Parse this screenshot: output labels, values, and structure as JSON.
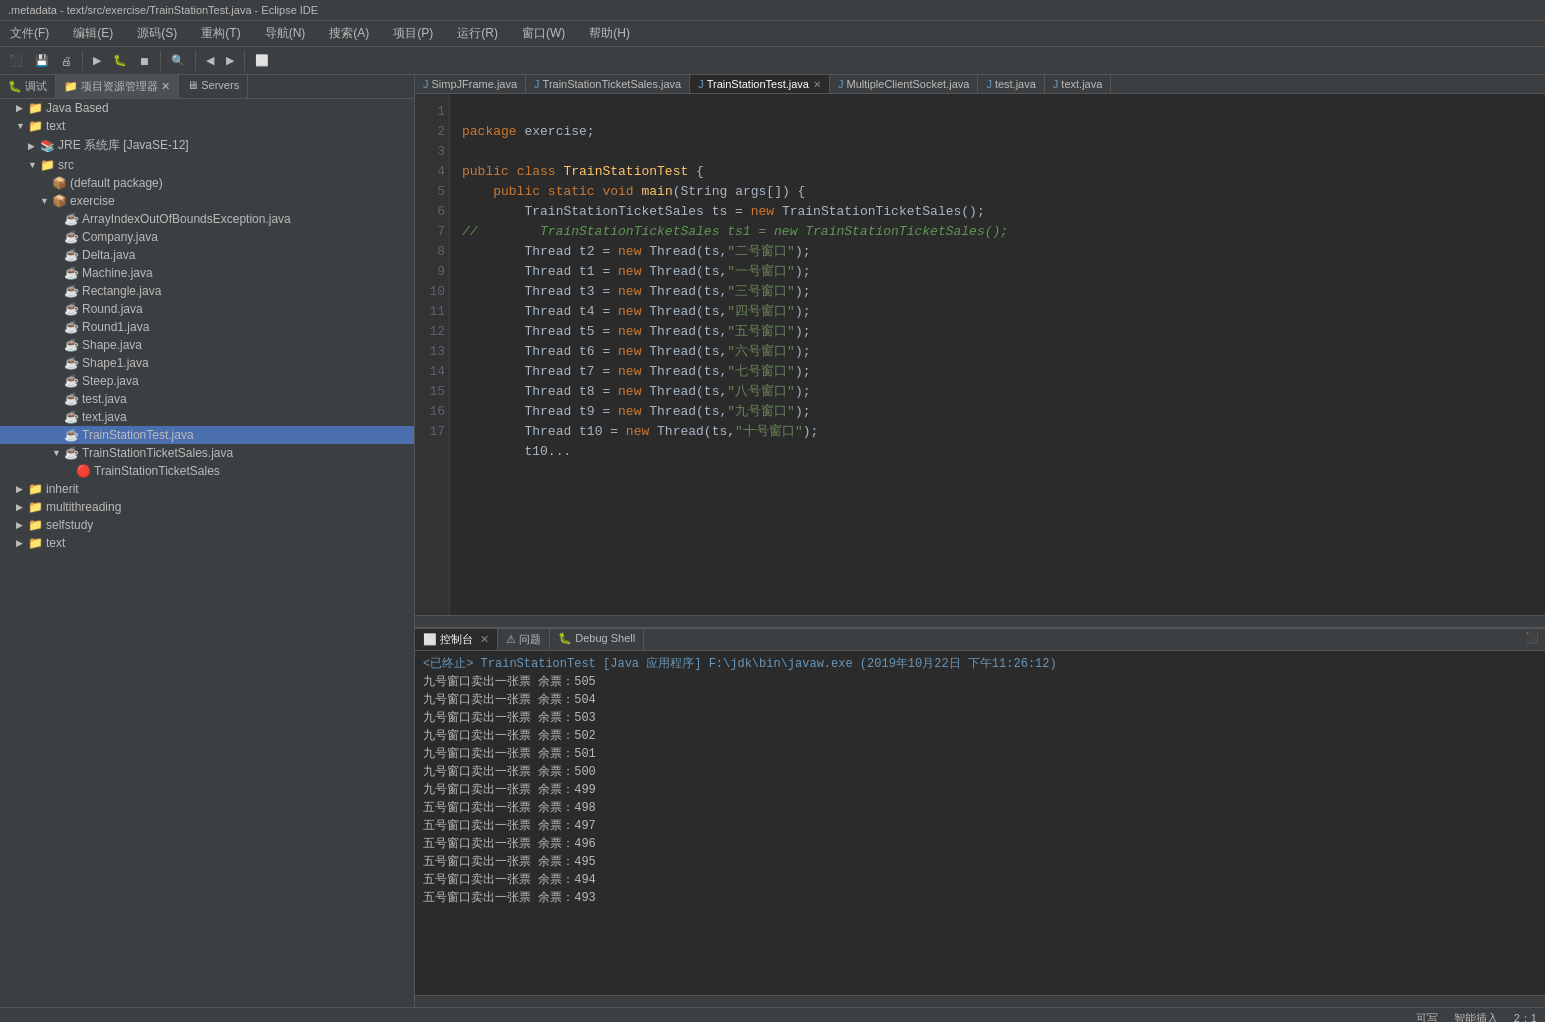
{
  "titleBar": {
    "text": ".metadata - text/src/exercise/TrainStationTest.java - Eclipse IDE"
  },
  "menuBar": {
    "items": [
      "文件(F)",
      "编辑(E)",
      "源码(S)",
      "重构(T)",
      "导航(N)",
      "搜索(A)",
      "项目(P)",
      "运行(R)",
      "窗口(W)",
      "帮助(H)"
    ]
  },
  "sidebar": {
    "tabs": [
      "调试",
      "项目资源管理器",
      "Servers"
    ],
    "tree": [
      {
        "label": "Java Based",
        "level": 1,
        "icon": "📁",
        "expanded": true
      },
      {
        "label": "text",
        "level": 1,
        "icon": "📁",
        "expanded": true
      },
      {
        "label": "JRE 系统库 [JavaSE-12]",
        "level": 2,
        "icon": "📚",
        "expanded": false
      },
      {
        "label": "src",
        "level": 2,
        "icon": "📁",
        "expanded": true
      },
      {
        "label": "(default package)",
        "level": 3,
        "icon": "📦",
        "expanded": false
      },
      {
        "label": "exercise",
        "level": 3,
        "icon": "📦",
        "expanded": true
      },
      {
        "label": "ArrayIndexOutOfBoundsException.java",
        "level": 4,
        "icon": "☕"
      },
      {
        "label": "Company.java",
        "level": 4,
        "icon": "☕"
      },
      {
        "label": "Delta.java",
        "level": 4,
        "icon": "☕"
      },
      {
        "label": "Machine.java",
        "level": 4,
        "icon": "☕"
      },
      {
        "label": "Rectangle.java",
        "level": 4,
        "icon": "☕"
      },
      {
        "label": "Round.java",
        "level": 4,
        "icon": "☕"
      },
      {
        "label": "Round1.java",
        "level": 4,
        "icon": "☕"
      },
      {
        "label": "Shape.java",
        "level": 4,
        "icon": "☕"
      },
      {
        "label": "Shape1.java",
        "level": 4,
        "icon": "☕"
      },
      {
        "label": "Steep.java",
        "level": 4,
        "icon": "☕"
      },
      {
        "label": "test.java",
        "level": 4,
        "icon": "☕"
      },
      {
        "label": "text.java",
        "level": 4,
        "icon": "☕"
      },
      {
        "label": "TrainStationTest.java",
        "level": 4,
        "icon": "☕",
        "selected": true
      },
      {
        "label": "TrainStationTicketSales.java",
        "level": 4,
        "icon": "☕"
      },
      {
        "label": "TrainStationTicketSales",
        "level": 5,
        "icon": "🔴"
      },
      {
        "label": "inherit",
        "level": 1,
        "icon": "📁",
        "expanded": false
      },
      {
        "label": "multithreading",
        "level": 1,
        "icon": "📁",
        "expanded": false
      },
      {
        "label": "selfstudy",
        "level": 1,
        "icon": "📁",
        "expanded": false
      },
      {
        "label": "text",
        "level": 1,
        "icon": "📁",
        "expanded": false
      }
    ]
  },
  "editorTabs": [
    {
      "label": "SimpJFrame.java",
      "icon": "J",
      "active": false
    },
    {
      "label": "TrainStationTicketSales.java",
      "icon": "J",
      "active": false
    },
    {
      "label": "TrainStationTest.java",
      "icon": "J",
      "active": true
    },
    {
      "label": "MultipleClientSocket.java",
      "icon": "J",
      "active": false
    },
    {
      "label": "test.java",
      "icon": "J",
      "active": false
    },
    {
      "label": "text.java",
      "icon": "J",
      "active": false
    }
  ],
  "codeLines": [
    {
      "num": 1,
      "text": "package exercise;"
    },
    {
      "num": 2,
      "text": ""
    },
    {
      "num": 3,
      "text": "public class TrainStationTest {"
    },
    {
      "num": 4,
      "text": "    public static void main(String args[]) {"
    },
    {
      "num": 5,
      "text": "        TrainStationTicketSales ts = new TrainStationTicketSales();"
    },
    {
      "num": 6,
      "text": "//        TrainStationTicketSales ts1 = new TrainStationTicketSales();"
    },
    {
      "num": 7,
      "text": "        Thread t2 = new Thread(ts,\"二号窗口\");"
    },
    {
      "num": 8,
      "text": "        Thread t1 = new Thread(ts,\"一号窗口\");"
    },
    {
      "num": 9,
      "text": "        Thread t3 = new Thread(ts,\"三号窗口\");"
    },
    {
      "num": 10,
      "text": "        Thread t4 = new Thread(ts,\"四号窗口\");"
    },
    {
      "num": 11,
      "text": "        Thread t5 = new Thread(ts,\"五号窗口\");"
    },
    {
      "num": 12,
      "text": "        Thread t6 = new Thread(ts,\"六号窗口\");"
    },
    {
      "num": 13,
      "text": "        Thread t7 = new Thread(ts,\"七号窗口\");"
    },
    {
      "num": 14,
      "text": "        Thread t8 = new Thread(ts,\"八号窗口\");"
    },
    {
      "num": 15,
      "text": "        Thread t9 = new Thread(ts,\"九号窗口\");"
    },
    {
      "num": 16,
      "text": "        Thread t10 = new Thread(ts,\"十号窗口\");"
    },
    {
      "num": 17,
      "text": "        t10..."
    }
  ],
  "bottomTabs": [
    {
      "label": "控制台",
      "active": true
    },
    {
      "label": "问题",
      "active": false
    },
    {
      "label": "Debug Shell",
      "active": false
    }
  ],
  "consoleOutput": {
    "header": "<已终止> TrainStationTest [Java 应用程序] F:\\jdk\\bin\\javaw.exe  (2019年10月22日 下午11:26:12)",
    "lines": [
      "九号窗口卖出一张票 余票：505",
      "九号窗口卖出一张票 余票：504",
      "九号窗口卖出一张票 余票：503",
      "九号窗口卖出一张票 余票：502",
      "九号窗口卖出一张票 余票：501",
      "九号窗口卖出一张票 余票：500",
      "九号窗口卖出一张票 余票：499",
      "五号窗口卖出一张票 余票：498",
      "五号窗口卖出一张票 余票：497",
      "五号窗口卖出一张票 余票：496",
      "五号窗口卖出一张票 余票：495",
      "五号窗口卖出一张票 余票：494",
      "五号窗口卖出一张票 余票：493"
    ]
  },
  "statusBar": {
    "writeMode": "可写",
    "smartInsert": "智能插入",
    "position": "2：1"
  }
}
